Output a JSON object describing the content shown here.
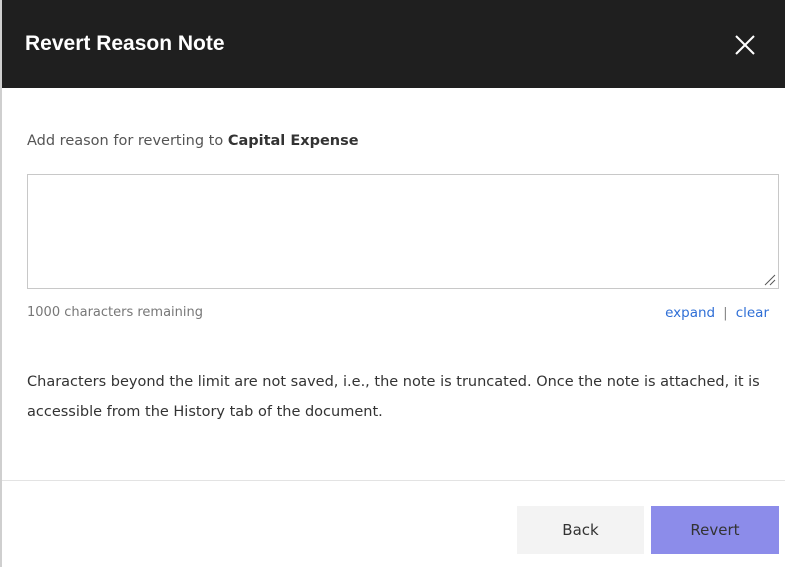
{
  "dialog": {
    "title": "Revert Reason Note",
    "close_icon": "close-icon",
    "intro_prefix": "Add reason for reverting to ",
    "intro_target": "Capital Expense",
    "note": {
      "value": "",
      "placeholder": ""
    },
    "remaining_text": "1000 characters remaining",
    "expand_label": "expand",
    "separator": "|",
    "clear_label": "clear",
    "info_text": "Characters beyond the limit are not saved, i.e., the note is truncated. Once the note is attached, it is accessible from the History tab of the document.",
    "back_label": "Back",
    "revert_label": "Revert"
  },
  "colors": {
    "header_bg": "#1f1f1f",
    "link": "#2f6fd6",
    "revert_button": "#8c8cea",
    "back_button": "#f3f3f3"
  }
}
